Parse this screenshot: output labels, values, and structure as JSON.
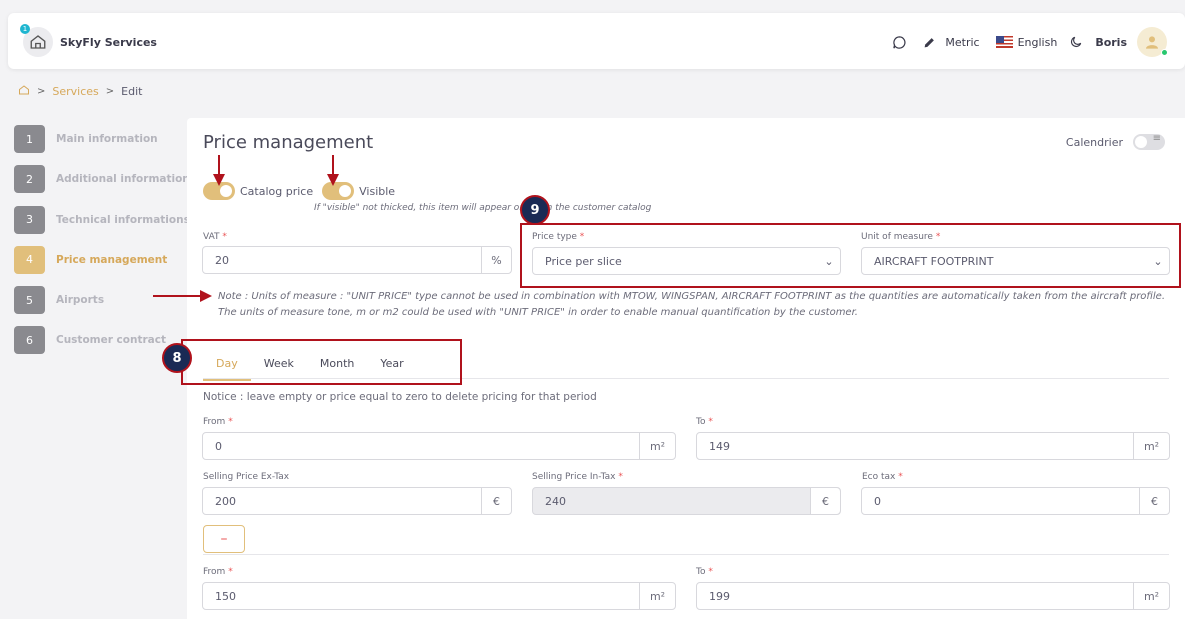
{
  "header": {
    "notification_count": "1",
    "app_name": "SkyFly Services",
    "unit_system": "Metric",
    "language": "English",
    "user_name": "Boris"
  },
  "breadcrumb": {
    "services": "Services",
    "current": "Edit"
  },
  "steps": [
    {
      "num": "1",
      "label": "Main information"
    },
    {
      "num": "2",
      "label": "Additional information"
    },
    {
      "num": "3",
      "label": "Technical informations"
    },
    {
      "num": "4",
      "label": "Price management"
    },
    {
      "num": "5",
      "label": "Airports"
    },
    {
      "num": "6",
      "label": "Customer contract"
    }
  ],
  "price": {
    "title": "Price management",
    "calendar_label": "Calendrier",
    "catalog_price_label": "Catalog price",
    "visible_label": "Visible",
    "visible_hint": "If \"visible\" not thicked, this item will appear online in the customer catalog",
    "vat_label": "VAT",
    "vat_value": "20",
    "vat_unit": "%",
    "price_type_label": "Price type",
    "price_type_value": "Price per slice",
    "unit_label": "Unit of measure",
    "unit_value": "AIRCRAFT FOOTPRINT",
    "note": "Note : Units of measure : \"UNIT PRICE\" type cannot be used in combination with MTOW, WINGSPAN, AIRCRAFT FOOTPRINT as the quantities are automatically taken from the aircraft profile. The units of measure tone, m or m2 could be used with \"UNIT PRICE\" in order to enable manual quantification by the customer.",
    "tabs": [
      "Day",
      "Week",
      "Month",
      "Year"
    ],
    "notice": "Notice : leave empty or price equal to zero to delete pricing for that period",
    "from_label": "From",
    "to_label": "To",
    "area_unit": "m²",
    "currency": "€",
    "row1": {
      "from": "0",
      "to": "149"
    },
    "selling_ex_label": "Selling Price Ex-Tax",
    "selling_ex_value": "200",
    "selling_in_label": "Selling Price In-Tax",
    "selling_in_value": "240",
    "eco_label": "Eco tax",
    "eco_value": "0",
    "minus": "–",
    "row2": {
      "from": "150",
      "to": "199"
    }
  },
  "annotations": {
    "badge_tabs": "8",
    "badge_price_type": "9"
  },
  "colors": {
    "accent": "#e1bf7b",
    "annotation_red": "#b0121c",
    "badge_navy": "#1a2a55"
  }
}
